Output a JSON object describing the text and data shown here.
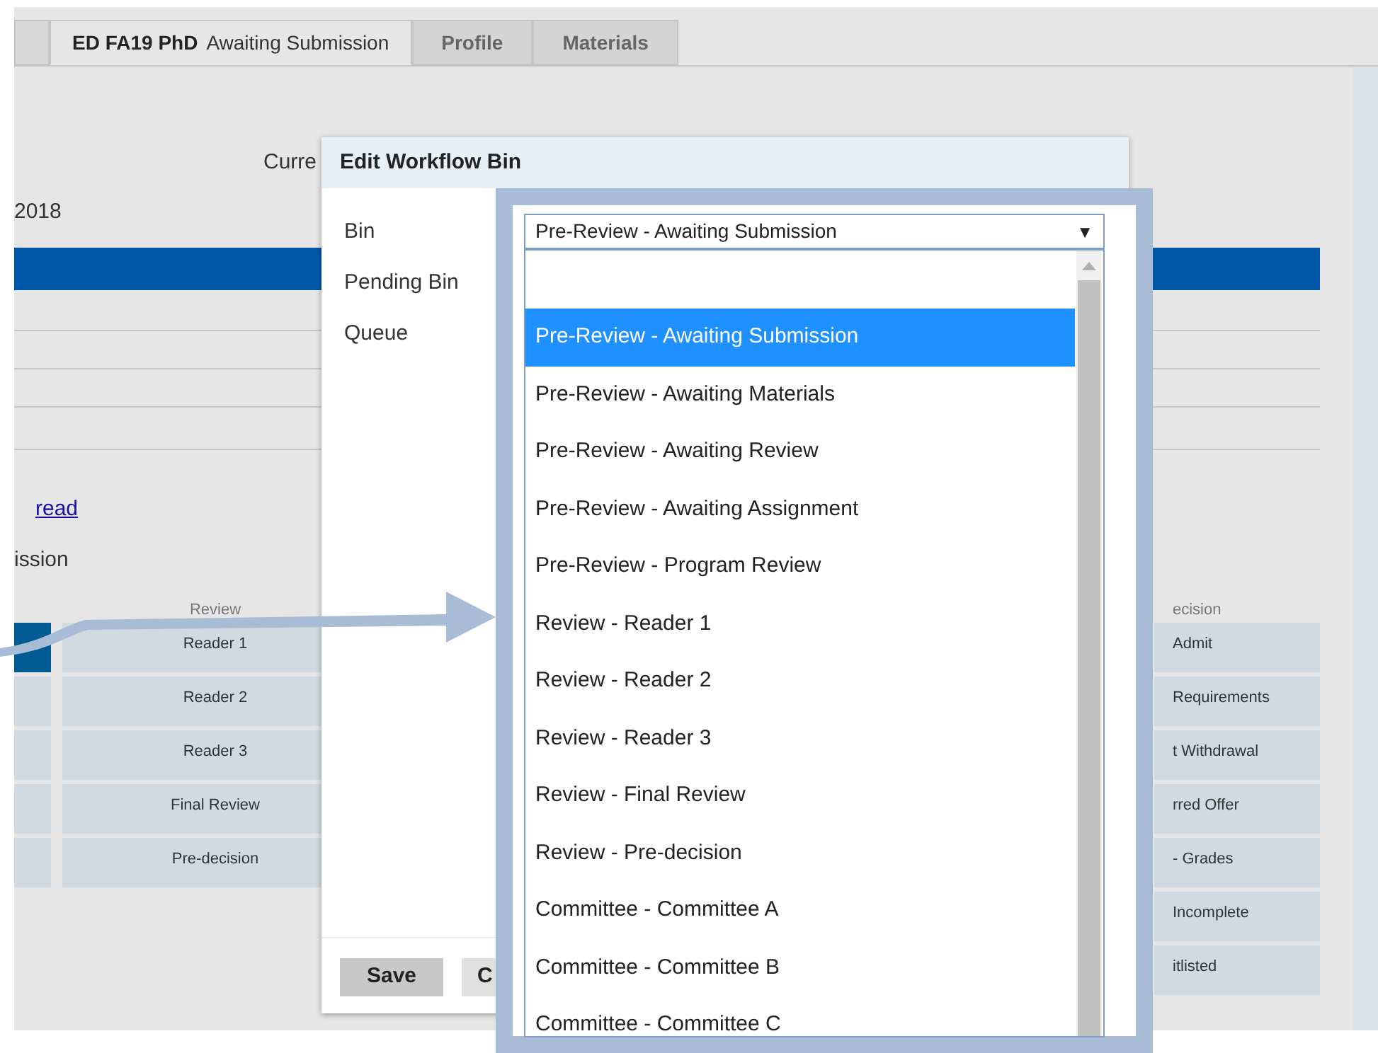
{
  "tabs": [
    {
      "label": "ED FA19 PhD",
      "sublabel": "Awaiting Submission",
      "selected": true
    },
    {
      "label": "Profile",
      "selected": false
    },
    {
      "label": "Materials",
      "selected": false
    }
  ],
  "background": {
    "current_label": "Curre",
    "date": "2018",
    "link": "read",
    "status": "ission"
  },
  "stage_column": [
    {
      "selected": true
    },
    {
      "selected": false
    },
    {
      "selected": false
    },
    {
      "selected": false
    },
    {
      "selected": false
    }
  ],
  "review_column": {
    "header": "Review",
    "rows": [
      "Reader 1",
      "Reader 2",
      "Reader 3",
      "Final Review",
      "Pre-decision"
    ]
  },
  "decision_column": {
    "header": "ecision",
    "rows": [
      "Admit",
      "Requirements",
      "t Withdrawal",
      "rred Offer",
      "- Grades",
      "Incomplete",
      "itlisted"
    ]
  },
  "dialog": {
    "title": "Edit Workflow Bin",
    "fields": [
      "Bin",
      "Pending Bin",
      "Queue"
    ],
    "bin_select": {
      "value": "Pre-Review - Awaiting Submission",
      "arrow": "▼",
      "options": [
        {
          "label": "Pre-Review - Awaiting Submission",
          "selected": true
        },
        {
          "label": "Pre-Review - Awaiting Materials",
          "selected": false
        },
        {
          "label": "Pre-Review - Awaiting Review",
          "selected": false
        },
        {
          "label": "Pre-Review - Awaiting Assignment",
          "selected": false
        },
        {
          "label": "Pre-Review - Program Review",
          "selected": false
        },
        {
          "label": "Review - Reader 1",
          "selected": false
        },
        {
          "label": "Review - Reader 2",
          "selected": false
        },
        {
          "label": "Review - Reader 3",
          "selected": false
        },
        {
          "label": "Review - Final Review",
          "selected": false
        },
        {
          "label": "Review - Pre-decision",
          "selected": false
        },
        {
          "label": "Committee - Committee A",
          "selected": false
        },
        {
          "label": "Committee - Committee B",
          "selected": false
        },
        {
          "label": "Committee - Committee C",
          "selected": false
        }
      ]
    },
    "buttons": [
      {
        "label": "Save",
        "kind": "primary"
      },
      {
        "label": "C",
        "kind": "secondary"
      }
    ]
  }
}
